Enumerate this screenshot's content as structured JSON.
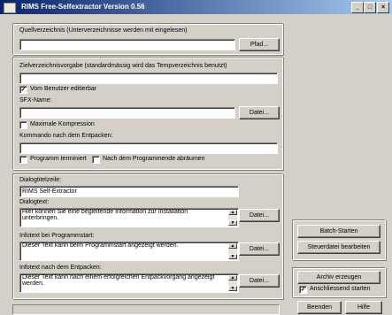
{
  "window": {
    "title": "RIMS Free-Selfextractor Version 0.56",
    "btn_min": "_",
    "btn_max": "□",
    "btn_close": "×"
  },
  "source": {
    "label": "Quellverzeichnis (Unterverzeichnisse werden mit eingelesen)",
    "value": "",
    "browse": "Pfad..."
  },
  "target": {
    "label": "Zielverzeichnisvorgabe (standardmässig wird das Tempverzeichnis benutzt)",
    "value": "",
    "user_editable_label": "Vom Benutzer editierbar",
    "user_editable_mark": "✓"
  },
  "sfx": {
    "label": "SFX-Name:",
    "value": "",
    "browse": "Datei...",
    "max_compression_label": "Maximale Kompression",
    "command_label": "Kommando nach dem Entpacken:",
    "command_value": "",
    "terminate_label": "Programm terminiert",
    "delete_label": "Nach dem Programmende abräumen"
  },
  "dialog_title": {
    "label": "Dialogtitelzeile:",
    "value": "RIMS Self-Extractor"
  },
  "dialog_text": {
    "label": "Dialogtext:",
    "value": "Hier können Sie eine begleitende Information zur Installation unterbringen.",
    "browse": "Datei..."
  },
  "info_start": {
    "label": "Infotext bei Programmstart:",
    "value": "Dieser Text kann beim Programmstart angezeigt werden.",
    "browse": "Datei..."
  },
  "info_after": {
    "label": "Infotext nach dem Entpacken:",
    "value": "Dieser Text kann nach einem erfolgreichen Entpackvorgang angezeigt werden.",
    "browse": "Datei..."
  },
  "side": {
    "batch_start": "Batch-Starten",
    "edit_control": "Steuerdatei bearbeiten",
    "create_archive": "Archiv erzeugen",
    "start_after_label": "Anschliessend starten",
    "start_after_mark": "✓",
    "quit": "Beenden",
    "help": "Hilfe"
  }
}
